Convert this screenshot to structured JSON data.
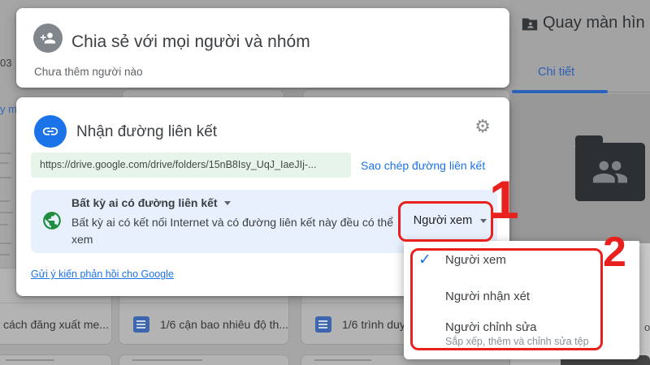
{
  "colors": {
    "accent_blue": "#1a73e8",
    "annotation_red": "#e8201e",
    "globe_green": "#1e8e3e",
    "url_pill_bg": "#e6f4ea",
    "perm_row_bg": "#e8f0fe"
  },
  "icons": {
    "gear": "⚙",
    "check": "✓"
  },
  "share_dialog": {
    "title": "Chia sẻ với mọi người và nhóm",
    "subtitle": "Chưa thêm người nào"
  },
  "link_dialog": {
    "title": "Nhận đường liên kết",
    "url": "https://drive.google.com/drive/folders/15nB8Isy_UqJ_IaeJIj-...",
    "copy_label": "Sao chép đường liên kết",
    "access_label": "Bất kỳ ai có đường liên kết",
    "access_description": "Bất kỳ ai có kết nối Internet và có đường liên kết này đều có thể xem",
    "role_button_label": "Người xem",
    "feedback_label": "Gửi ý kiến phản hồi cho Google"
  },
  "role_menu": {
    "items": [
      {
        "label": "Người xem",
        "checked": true
      },
      {
        "label": "Người nhận xét",
        "checked": false
      },
      {
        "label": "Người chỉnh sửa",
        "checked": false,
        "description": "Sắp xếp, thêm và chỉnh sửa tệp"
      }
    ]
  },
  "annotations": {
    "step_1": "1",
    "step_2": "2"
  },
  "background": {
    "details_panel": {
      "title": "Quay màn hìn",
      "active_tab": "Chi tiết"
    },
    "left_fragments": {
      "number": "03",
      "link_text": "y m",
      "letter": "o"
    },
    "file_cards": [
      {
        "name": "cách đăng xuất me..."
      },
      {
        "name": "1/6 cận bao nhiêu độ th..."
      },
      {
        "name": "1/6 trình duy"
      }
    ]
  }
}
